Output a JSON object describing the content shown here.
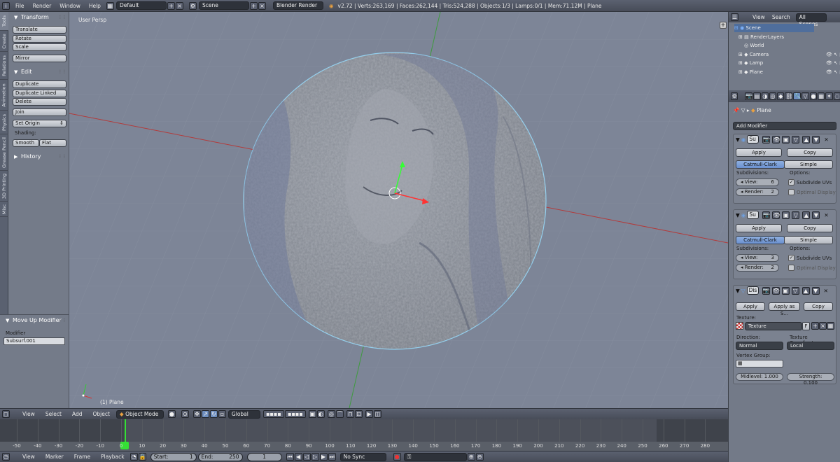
{
  "topbar": {
    "menus": [
      "File",
      "Render",
      "Window",
      "Help"
    ],
    "layout": "Default",
    "scene": "Scene",
    "engine": "Blender Render",
    "stats": "v2.72 | Verts:263,169 | Faces:262,144 | Tris:524,288 | Objects:1/3 | Lamps:0/1 | Mem:71.12M | Plane"
  },
  "vtabs": [
    "Tools",
    "Create",
    "Relations",
    "Animation",
    "Physics",
    "Grease Pencil",
    "3D Printing",
    "Misc"
  ],
  "tools": {
    "transform_header": "Transform",
    "translate": "Translate",
    "rotate": "Rotate",
    "scale": "Scale",
    "mirror": "Mirror",
    "edit_header": "Edit",
    "duplicate": "Duplicate",
    "duplicate_linked": "Duplicate Linked",
    "delete": "Delete",
    "join": "Join",
    "set_origin": "Set Origin",
    "shading_label": "Shading:",
    "smooth": "Smooth",
    "flat": "Flat",
    "history_header": "History"
  },
  "operator_panel": {
    "header": "Move Up Modifier",
    "label": "Modifier",
    "value": "Subsurf.001"
  },
  "viewport": {
    "label": "User Persp",
    "object_label": "(1) Plane",
    "bg": "#7d8597"
  },
  "viewport_header": {
    "menus": [
      "View",
      "Select",
      "Add",
      "Object"
    ],
    "mode": "Object Mode",
    "orientation": "Global"
  },
  "timeline": {
    "ticks": [
      "-50",
      "-40",
      "-30",
      "-20",
      "-10",
      "0",
      "10",
      "20",
      "30",
      "40",
      "50",
      "60",
      "70",
      "80",
      "90",
      "100",
      "110",
      "120",
      "130",
      "140",
      "150",
      "160",
      "170",
      "180",
      "190",
      "200",
      "210",
      "220",
      "230",
      "240",
      "250",
      "260",
      "270",
      "280"
    ],
    "menus": [
      "View",
      "Marker",
      "Frame",
      "Playback"
    ],
    "start_label": "Start:",
    "start": "1",
    "end_label": "End:",
    "end": "250",
    "current": "1",
    "sync": "No Sync"
  },
  "outliner": {
    "menus": [
      "View",
      "Search"
    ],
    "filter": "All Scenes",
    "items": [
      "Scene",
      "RenderLayers",
      "World",
      "Camera",
      "Lamp",
      "Plane"
    ]
  },
  "properties": {
    "object_name": "Plane",
    "add_modifier": "Add Modifier",
    "mod1": {
      "name": "Su",
      "apply": "Apply",
      "copy": "Copy",
      "catmull": "Catmull-Clark",
      "simple": "Simple",
      "subdivisions": "Subdivisions:",
      "options": "Options:",
      "view_label": "View:",
      "view": "6",
      "render_label": "Render:",
      "render": "2",
      "subdivide_uvs": "Subdivide UVs",
      "optimal": "Optimal Display"
    },
    "mod2": {
      "name": "Su",
      "apply": "Apply",
      "copy": "Copy",
      "catmull": "Catmull-Clark",
      "simple": "Simple",
      "subdivisions": "Subdivisions:",
      "options": "Options:",
      "view_label": "View:",
      "view": "3",
      "render_label": "Render:",
      "render": "2",
      "subdivide_uvs": "Subdivide UVs",
      "optimal": "Optimal Display"
    },
    "mod3": {
      "name": "Dis",
      "apply": "Apply",
      "apply_as": "Apply as S...",
      "copy": "Copy",
      "texture_label": "Texture:",
      "texture": "Texture",
      "texture_f": "F",
      "direction_label": "Direction:",
      "direction": "Normal",
      "coords_label": "Texture Coordinates:",
      "coords": "Local",
      "vgroup_label": "Vertex Group:",
      "midlevel": "Midlevel: 1.000",
      "strength": "Strength: 0.100"
    }
  }
}
